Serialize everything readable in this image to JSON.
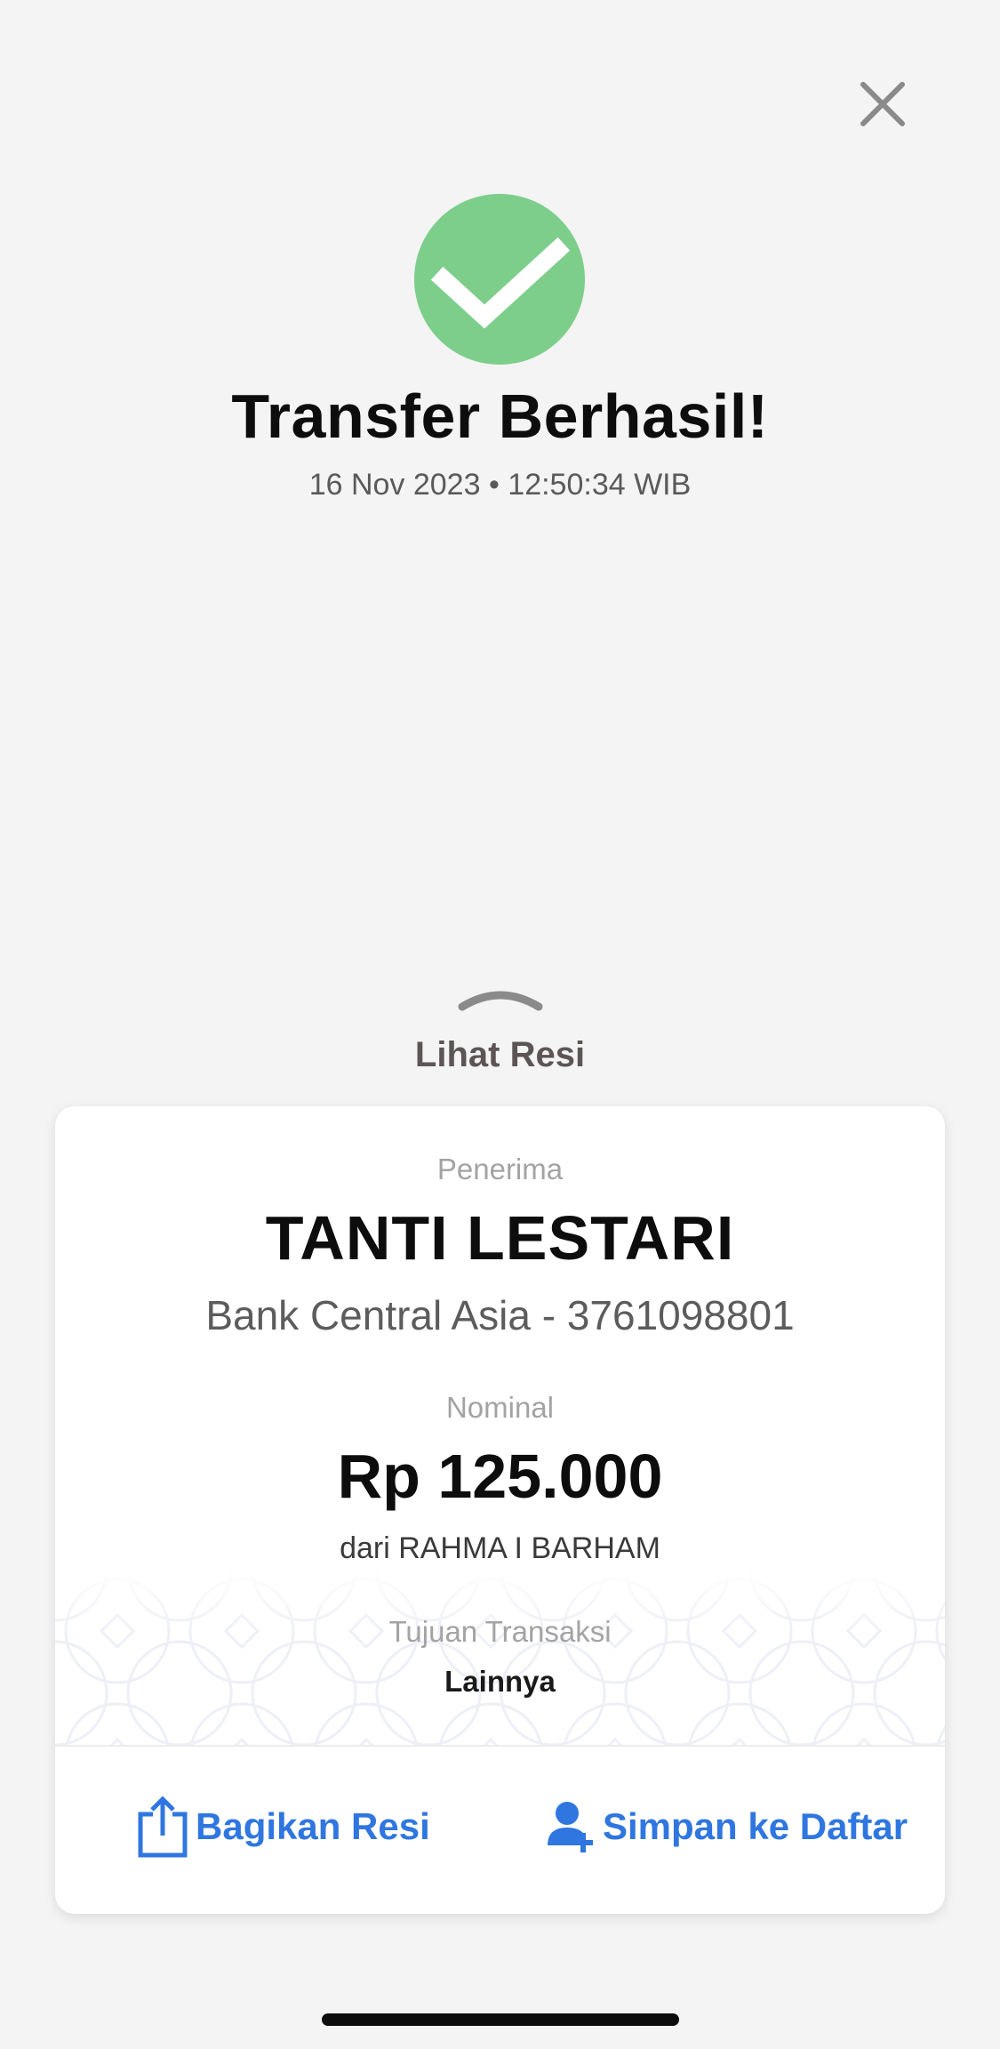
{
  "header": {
    "close_icon": "close-icon",
    "status_icon": "check-circle-icon",
    "status_color": "#7dce8b",
    "title": "Transfer Berhasil!",
    "timestamp": "16 Nov 2023 • 12:50:34 WIB"
  },
  "receipt_toggle": {
    "icon": "chevron-up-icon",
    "label": "Lihat Resi"
  },
  "receipt": {
    "recipient_label": "Penerima",
    "recipient_name": "TANTI LESTARI",
    "recipient_bank": "Bank Central Asia - 3761098801",
    "amount_label": "Nominal",
    "amount": "Rp 125.000",
    "sender": "dari RAHMA I BARHAM",
    "purpose_label": "Tujuan Transaksi",
    "purpose_value": "Lainnya"
  },
  "actions": {
    "share": {
      "icon": "share-icon",
      "label": "Bagikan Resi"
    },
    "save": {
      "icon": "add-user-icon",
      "label": "Simpan ke Daftar"
    },
    "accent_color": "#2f76e0"
  }
}
